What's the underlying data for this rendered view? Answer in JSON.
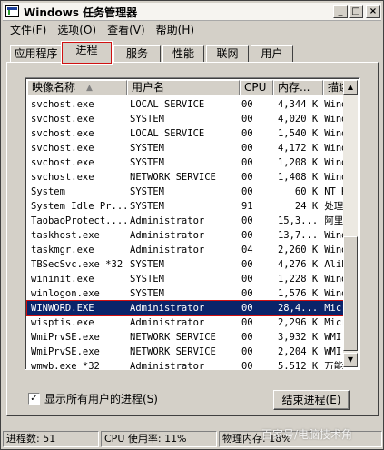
{
  "window": {
    "title": "Windows 任务管理器",
    "controls": {
      "minimize": "_",
      "maximize": "□",
      "close": "×"
    }
  },
  "menu": [
    "文件(F)",
    "选项(O)",
    "查看(V)",
    "帮助(H)"
  ],
  "tabs": [
    {
      "label": "应用程序",
      "active": false
    },
    {
      "label": "进程",
      "active": true
    },
    {
      "label": "服务",
      "active": false
    },
    {
      "label": "性能",
      "active": false
    },
    {
      "label": "联网",
      "active": false
    },
    {
      "label": "用户",
      "active": false
    }
  ],
  "columns": {
    "name": "映像名称",
    "user": "用户名",
    "cpu": "CPU",
    "mem": "内存...",
    "desc": "描述"
  },
  "processes": [
    {
      "name": "svchost.exe",
      "user": "LOCAL SERVICE",
      "cpu": "00",
      "mem": "4,344 K",
      "desc": "Wind"
    },
    {
      "name": "svchost.exe",
      "user": "SYSTEM",
      "cpu": "00",
      "mem": "4,020 K",
      "desc": "Wind"
    },
    {
      "name": "svchost.exe",
      "user": "LOCAL SERVICE",
      "cpu": "00",
      "mem": "1,540 K",
      "desc": "Wind"
    },
    {
      "name": "svchost.exe",
      "user": "SYSTEM",
      "cpu": "00",
      "mem": "4,172 K",
      "desc": "Wind"
    },
    {
      "name": "svchost.exe",
      "user": "SYSTEM",
      "cpu": "00",
      "mem": "1,208 K",
      "desc": "Wind"
    },
    {
      "name": "svchost.exe",
      "user": "NETWORK SERVICE",
      "cpu": "00",
      "mem": "1,408 K",
      "desc": "Wind"
    },
    {
      "name": "System",
      "user": "SYSTEM",
      "cpu": "00",
      "mem": "60 K",
      "desc": "NT K"
    },
    {
      "name": "System Idle Pr...",
      "user": "SYSTEM",
      "cpu": "91",
      "mem": "24 K",
      "desc": "处理"
    },
    {
      "name": "TaobaoProtect....",
      "user": "Administrator",
      "cpu": "00",
      "mem": "15,3...",
      "desc": "阿里"
    },
    {
      "name": "taskhost.exe",
      "user": "Administrator",
      "cpu": "00",
      "mem": "13,7...",
      "desc": "Wind"
    },
    {
      "name": "taskmgr.exe",
      "user": "Administrator",
      "cpu": "04",
      "mem": "2,260 K",
      "desc": "Wind"
    },
    {
      "name": "TBSecSvc.exe *32",
      "user": "SYSTEM",
      "cpu": "00",
      "mem": "4,276 K",
      "desc": "Alib"
    },
    {
      "name": "wininit.exe",
      "user": "SYSTEM",
      "cpu": "00",
      "mem": "1,228 K",
      "desc": "Wind"
    },
    {
      "name": "winlogon.exe",
      "user": "SYSTEM",
      "cpu": "00",
      "mem": "1,576 K",
      "desc": "Wind"
    },
    {
      "name": "WINWORD.EXE",
      "user": "Administrator",
      "cpu": "00",
      "mem": "28,4...",
      "desc": "Micr"
    },
    {
      "name": "wisptis.exe",
      "user": "Administrator",
      "cpu": "00",
      "mem": "2,296 K",
      "desc": "Micr"
    },
    {
      "name": "WmiPrvSE.exe",
      "user": "NETWORK SERVICE",
      "cpu": "00",
      "mem": "3,932 K",
      "desc": "WMI"
    },
    {
      "name": "WmiPrvSE.exe",
      "user": "NETWORK SERVICE",
      "cpu": "00",
      "mem": "2,204 K",
      "desc": "WMI"
    },
    {
      "name": "wmwb.exe *32",
      "user": "Administrator",
      "cpu": "00",
      "mem": "5,512 K",
      "desc": "万能"
    }
  ],
  "selected_process": "WINWORD.EXE",
  "show_all_users": {
    "label": "显示所有用户的进程(S)",
    "checked": true
  },
  "end_process_label": "结束进程(E)",
  "status": {
    "processes": "进程数: 51",
    "cpu": "CPU 使用率: 11%",
    "memory": "物理内存: 18%"
  },
  "watermark": "百家号/电脑技术角",
  "colors": {
    "selection": "#0a246a",
    "highlight_border": "#d01010",
    "face": "#d4d0c8"
  }
}
